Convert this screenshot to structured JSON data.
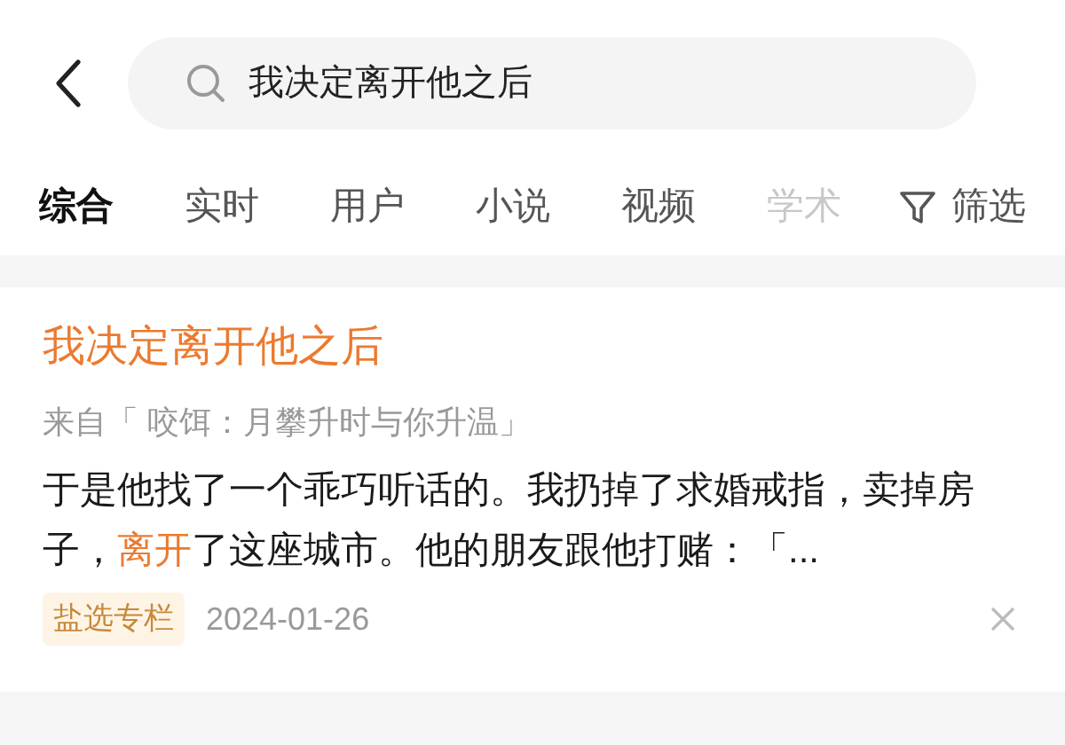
{
  "search": {
    "value": "我决定离开他之后"
  },
  "tabs": [
    {
      "label": "综合",
      "selected": true
    },
    {
      "label": "实时",
      "selected": false
    },
    {
      "label": "用户",
      "selected": false
    },
    {
      "label": "小说",
      "selected": false
    },
    {
      "label": "视频",
      "selected": false
    },
    {
      "label": "学术",
      "selected": false
    }
  ],
  "filter": {
    "label": "筛选"
  },
  "results": [
    {
      "title": "我决定离开他之后",
      "source": "来自「 咬饵：月攀升时与你升温」",
      "snippet": [
        {
          "text": "于是他找了一个乖巧听话的。我扔掉了求婚戒指，卖掉房子，",
          "highlight": false
        },
        {
          "text": "离开",
          "highlight": true
        },
        {
          "text": "了这座城市。他的朋友跟他打赌：「...",
          "highlight": false
        }
      ],
      "tag": "盐选专栏",
      "date": "2024-01-26"
    }
  ]
}
